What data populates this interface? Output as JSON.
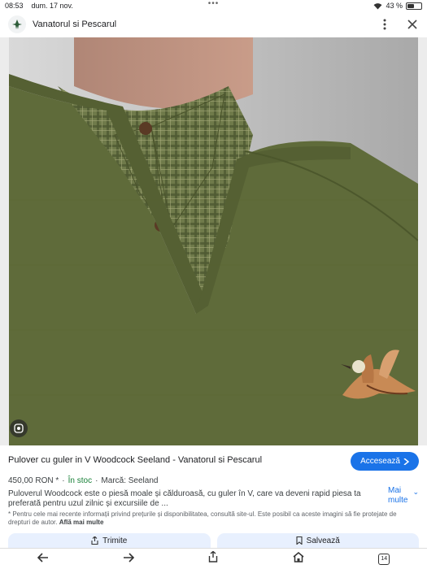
{
  "status": {
    "time": "08:53",
    "date": "dum. 17 nov.",
    "battery": "43 %",
    "battery_level": 0.43
  },
  "header": {
    "site_name": "Vanatorul si Pescarul",
    "logo_icon": "bird-logo-icon",
    "more_icon": "more-vert-icon",
    "close_icon": "close-icon"
  },
  "product": {
    "title": "Pulover cu guler in V Woodcock Seeland - Vanatorul si Pescarul",
    "price": "450,00 RON *",
    "stock": "În stoc",
    "brand": "Marcă: Seeland",
    "description": "Puloverul Woodcock este o piesă moale și călduroasă, cu guler în V, care va deveni rapid piesa ta preferată pentru uzul zilnic și excursiile de ...",
    "more_label": "Mai multe",
    "disclaimer": "* Pentru cele mai recente informații privind prețurile și disponibilitatea, consultă site-ul. Este posibil ca aceste imagini să fie protejate de drepturi de autor.",
    "learn_more": "Află mai multe"
  },
  "buttons": {
    "visit": "Accesează",
    "share": "Trimite",
    "save": "Salvează"
  },
  "nav": {
    "tab_count": "14"
  },
  "colors": {
    "accent": "#1a73e8",
    "stock_green": "#188038",
    "sweater": "#5f6b3a"
  }
}
